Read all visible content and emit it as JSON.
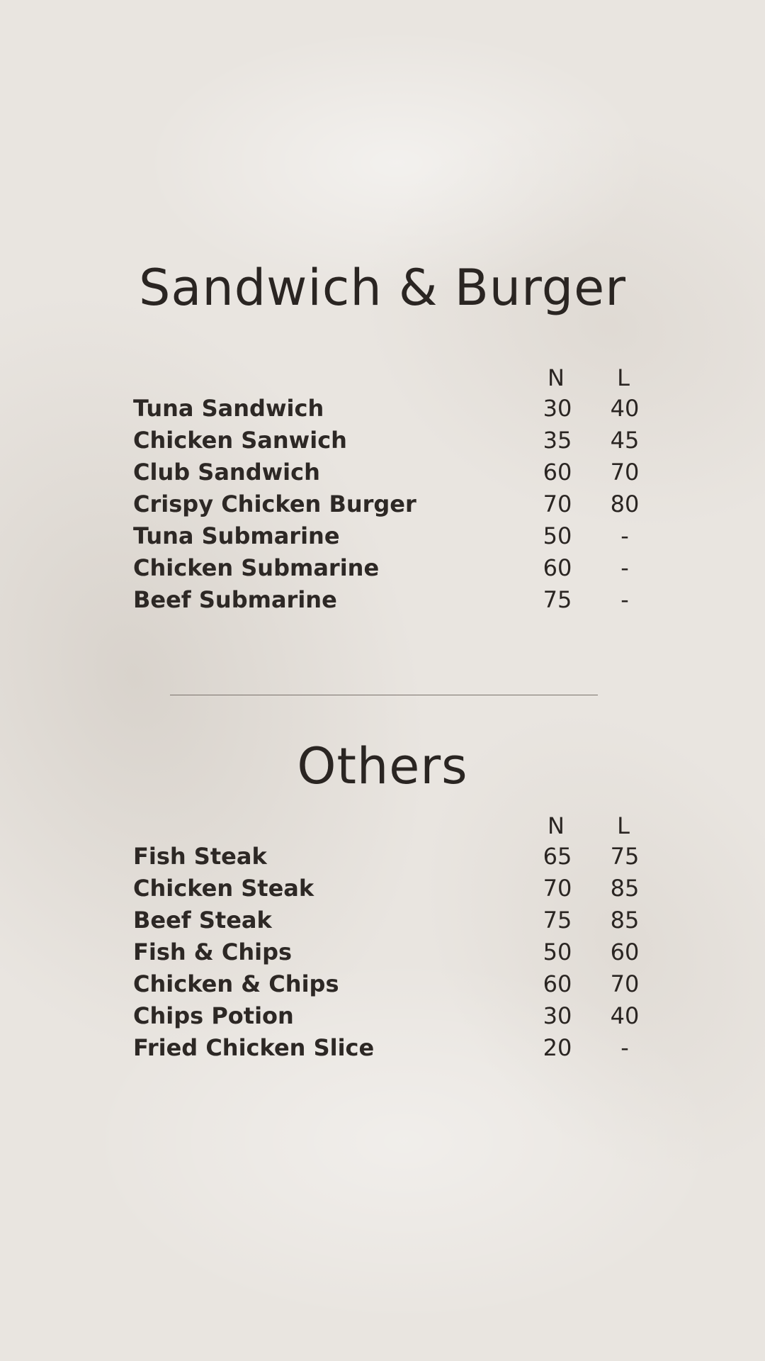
{
  "sections": [
    {
      "title": "Sandwich & Burger",
      "columns": {
        "n": "N",
        "l": "L"
      },
      "items": [
        {
          "name": "Tuna Sandwich",
          "n": "30",
          "l": "40"
        },
        {
          "name": "Chicken Sanwich",
          "n": "35",
          "l": "45"
        },
        {
          "name": "Club Sandwich",
          "n": "60",
          "l": "70"
        },
        {
          "name": "Crispy Chicken Burger",
          "n": "70",
          "l": "80"
        },
        {
          "name": "Tuna Submarine",
          "n": "50",
          "l": "-"
        },
        {
          "name": "Chicken Submarine",
          "n": "60",
          "l": "-"
        },
        {
          "name": "Beef Submarine",
          "n": "75",
          "l": "-"
        }
      ]
    },
    {
      "title": "Others",
      "columns": {
        "n": "N",
        "l": "L"
      },
      "items": [
        {
          "name": "Fish Steak",
          "n": "65",
          "l": "75"
        },
        {
          "name": "Chicken Steak",
          "n": "70",
          "l": "85"
        },
        {
          "name": "Beef Steak",
          "n": "75",
          "l": "85"
        },
        {
          "name": "Fish & Chips",
          "n": "50",
          "l": "60"
        },
        {
          "name": "Chicken & Chips",
          "n": "60",
          "l": "70"
        },
        {
          "name": "Chips Potion",
          "n": "30",
          "l": "40"
        },
        {
          "name": "Fried Chicken Slice",
          "n": "20",
          "l": "-"
        }
      ]
    }
  ],
  "colors": {
    "background": "#e9e5e0",
    "text": "#2a2522",
    "divider": "#7a726c"
  }
}
